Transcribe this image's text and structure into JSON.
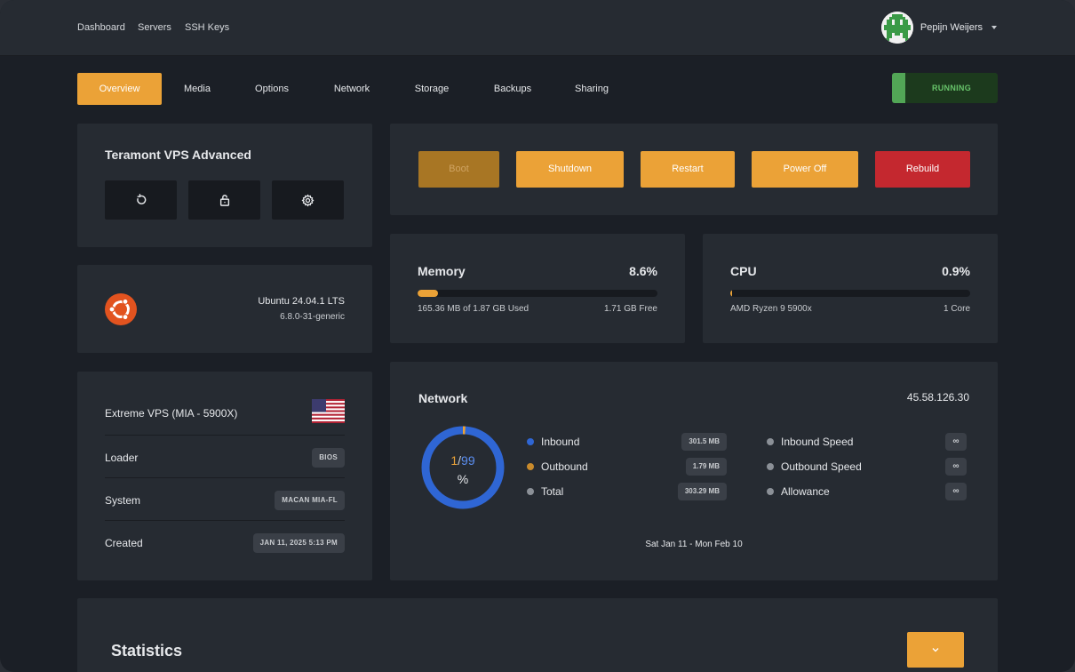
{
  "nav": {
    "links": [
      "Dashboard",
      "Servers",
      "SSH Keys"
    ]
  },
  "user": {
    "name": "Pepijn Weijers"
  },
  "tabs": [
    "Overview",
    "Media",
    "Options",
    "Network",
    "Storage",
    "Backups",
    "Sharing"
  ],
  "status": {
    "label": "RUNNING",
    "color": "#52a656"
  },
  "server": {
    "name": "Teramont VPS Advanced"
  },
  "os": {
    "name": "Ubuntu 24.04.1 LTS",
    "kernel": "6.8.0-31-generic"
  },
  "plan": {
    "name": "Extreme VPS (MIA - 5900X)",
    "rows": [
      {
        "label": "Loader",
        "value": "BIOS"
      },
      {
        "label": "System",
        "value": "MACAN MIA-FL"
      },
      {
        "label": "Created",
        "value": "JAN 11, 2025 5:13 PM"
      }
    ]
  },
  "power": {
    "boot": "Boot",
    "shutdown": "Shutdown",
    "restart": "Restart",
    "power_off": "Power Off",
    "rebuild": "Rebuild"
  },
  "memory": {
    "title": "Memory",
    "percent": "8.6%",
    "fraction": 0.086,
    "used": "165.36 MB of 1.87 GB Used",
    "free": "1.71 GB Free"
  },
  "cpu": {
    "title": "CPU",
    "percent": "0.9%",
    "fraction": 0.009,
    "model": "AMD Ryzen 9 5900x",
    "cores": "1 Core"
  },
  "network": {
    "title": "Network",
    "ip": "45.58.126.30",
    "used": "1",
    "separator": "/",
    "remaining": "99",
    "unit": "%",
    "used_fraction": 0.01,
    "inbound": {
      "label": "Inbound",
      "value": "301.5 MB",
      "color": "#2f66d4"
    },
    "outbound": {
      "label": "Outbound",
      "value": "1.79 MB",
      "color": "#eba237"
    },
    "total": {
      "label": "Total",
      "value": "303.29 MB",
      "color": "#8b9097"
    },
    "inbound_speed": {
      "label": "Inbound Speed",
      "value": "∞"
    },
    "outbound_speed": {
      "label": "Outbound Speed",
      "value": "∞"
    },
    "allowance": {
      "label": "Allowance",
      "value": "∞"
    },
    "period": "Sat Jan 11 - Mon Feb 10"
  },
  "statistics": {
    "title": "Statistics"
  }
}
